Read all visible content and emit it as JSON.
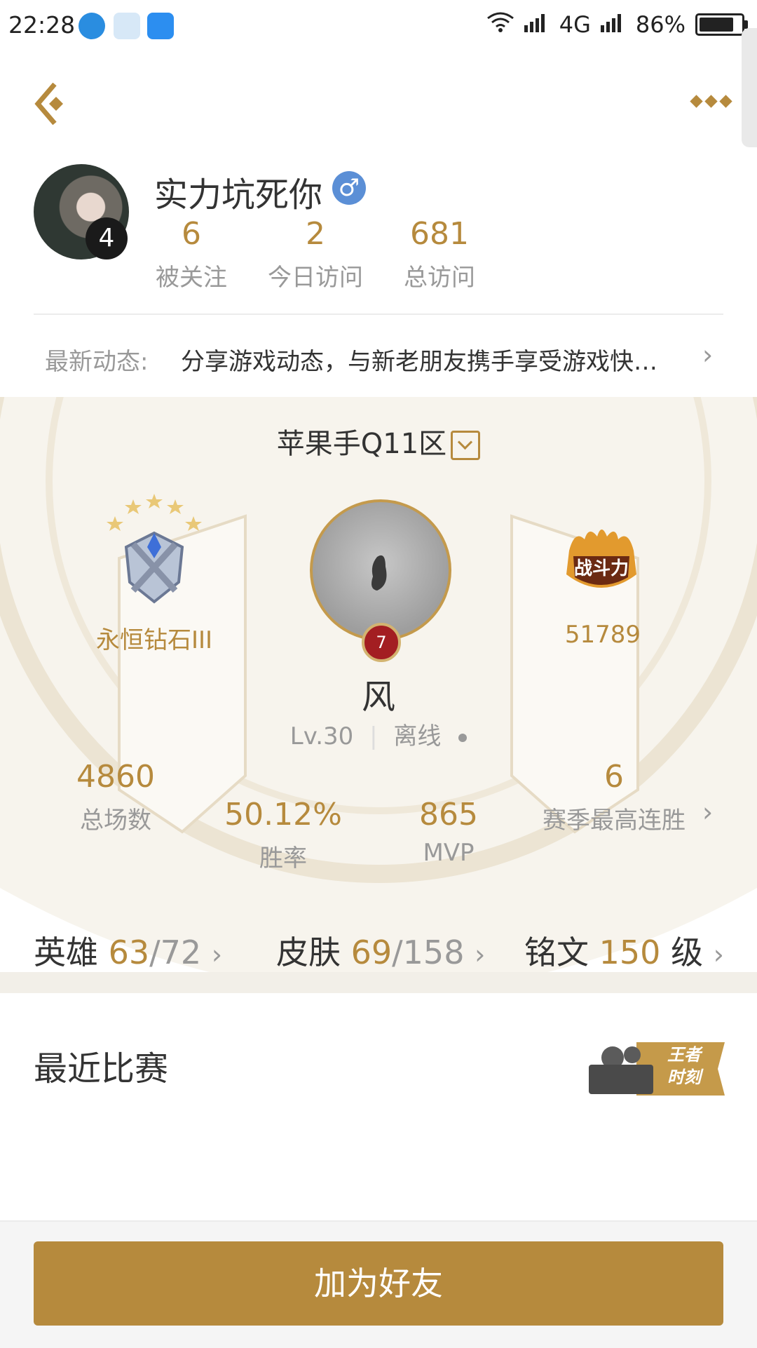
{
  "status_bar": {
    "time": "22:28",
    "network": "4G",
    "battery": "86%"
  },
  "profile": {
    "username": "实力坑死你",
    "gender_symbol": "♂",
    "avatar_badge": "4",
    "stats": [
      {
        "value": "6",
        "label": "被关注"
      },
      {
        "value": "2",
        "label": "今日访问"
      },
      {
        "value": "681",
        "label": "总访问"
      }
    ]
  },
  "feed": {
    "label": "最新动态:",
    "text": "分享游戏动态，与新老朋友携手享受游戏快…"
  },
  "game": {
    "server": "苹果手Q11区",
    "rank": "永恒钻石III",
    "power": "51789",
    "power_badge": "战斗力",
    "hero_level_badge": "7",
    "hero_name": "风",
    "level": "Lv.30",
    "status": "离线",
    "stats": {
      "total_games": {
        "value": "4860",
        "label": "总场数"
      },
      "win_rate": {
        "value": "50.12%",
        "label": "胜率"
      },
      "mvp": {
        "value": "865",
        "label": "MVP"
      },
      "streak": {
        "value": "6",
        "label": "赛季最高连胜"
      }
    }
  },
  "collection": {
    "heroes": {
      "label": "英雄",
      "owned": "63",
      "total": "/72"
    },
    "skins": {
      "label": "皮肤",
      "owned": "69",
      "total": "/158"
    },
    "runes": {
      "label": "铭文",
      "value": "150",
      "unit": "级"
    }
  },
  "recent": {
    "title": "最近比赛",
    "moment_label_1": "王者",
    "moment_label_2": "时刻"
  },
  "footer": {
    "add_friend": "加为好友"
  },
  "colors": {
    "accent": "#b68a3d",
    "panel_bg": "#f7f4ed"
  }
}
